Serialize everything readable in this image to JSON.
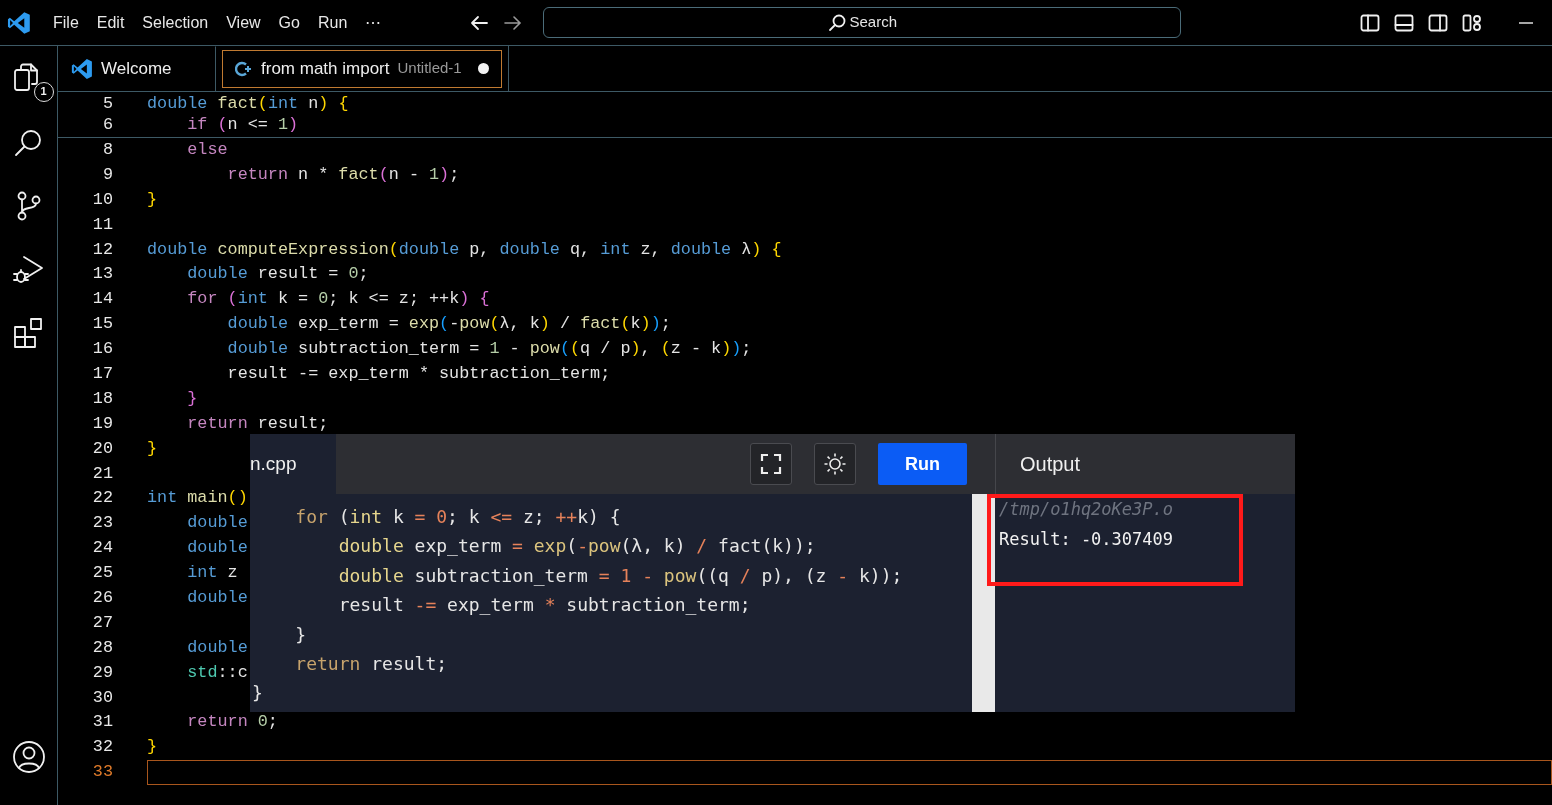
{
  "title_bar": {
    "menu": [
      "File",
      "Edit",
      "Selection",
      "View",
      "Go",
      "Run",
      "⋯"
    ],
    "command_center": "Search"
  },
  "activity_bar": {
    "items": [
      {
        "kind": "explorer",
        "badge": "1"
      },
      {
        "kind": "search"
      },
      {
        "kind": "source_control"
      },
      {
        "kind": "run_debug"
      },
      {
        "kind": "extensions"
      }
    ]
  },
  "tabs": [
    {
      "label": "Welcome",
      "kind": "welcome",
      "selected": false,
      "modified": false
    },
    {
      "label": "from math import",
      "description": "Untitled-1",
      "kind": "cpp",
      "selected": true,
      "modified": true
    }
  ],
  "editor": {
    "sticky_lines": [
      {
        "number": "5",
        "tokens": [
          {
            "text": "double ",
            "kind": "type"
          },
          {
            "text": "fact",
            "kind": "fn"
          },
          {
            "text": "(",
            "kind": "b1"
          },
          {
            "text": "int",
            "kind": "type"
          },
          {
            "text": " n",
            "kind": "plain"
          },
          {
            "text": ") {",
            "kind": "b1"
          }
        ]
      },
      {
        "number": "6",
        "tokens": [
          {
            "text": "    if ",
            "kind": "ctl"
          },
          {
            "text": "(",
            "kind": "b2"
          },
          {
            "text": "n <= ",
            "kind": "plain"
          },
          {
            "text": "1",
            "kind": "num"
          },
          {
            "text": ")",
            "kind": "b2"
          }
        ]
      }
    ],
    "lines": [
      {
        "number": "8",
        "current": false,
        "tokens": [
          {
            "text": "    else",
            "kind": "ctl"
          }
        ]
      },
      {
        "number": "9",
        "current": false,
        "tokens": [
          {
            "text": "        return",
            "kind": "ctl"
          },
          {
            "text": " n * ",
            "kind": "plain"
          },
          {
            "text": "fact",
            "kind": "fn"
          },
          {
            "text": "(",
            "kind": "b2"
          },
          {
            "text": "n - ",
            "kind": "plain"
          },
          {
            "text": "1",
            "kind": "num"
          },
          {
            "text": ")",
            "kind": "b2"
          },
          {
            "text": ";",
            "kind": "plain"
          }
        ]
      },
      {
        "number": "10",
        "current": false,
        "tokens": [
          {
            "text": "}",
            "kind": "b1"
          }
        ]
      },
      {
        "number": "11",
        "current": false
      },
      {
        "number": "12",
        "current": false,
        "tokens": [
          {
            "text": "double ",
            "kind": "type"
          },
          {
            "text": "computeExpression",
            "kind": "fn"
          },
          {
            "text": "(",
            "kind": "b1"
          },
          {
            "text": "double",
            "kind": "type"
          },
          {
            "text": " p, ",
            "kind": "plain"
          },
          {
            "text": "double",
            "kind": "type"
          },
          {
            "text": " q, ",
            "kind": "plain"
          },
          {
            "text": "int",
            "kind": "type"
          },
          {
            "text": " z, ",
            "kind": "plain"
          },
          {
            "text": "double",
            "kind": "type"
          },
          {
            "text": " λ",
            "kind": "plain"
          },
          {
            "text": ") {",
            "kind": "b1"
          }
        ]
      },
      {
        "number": "13",
        "current": false,
        "tokens": [
          {
            "text": "    double",
            "kind": "type"
          },
          {
            "text": " result = ",
            "kind": "plain"
          },
          {
            "text": "0",
            "kind": "num"
          },
          {
            "text": ";",
            "kind": "plain"
          }
        ]
      },
      {
        "number": "14",
        "current": false,
        "tokens": [
          {
            "text": "    for ",
            "kind": "ctl"
          },
          {
            "text": "(",
            "kind": "b2"
          },
          {
            "text": "int",
            "kind": "type"
          },
          {
            "text": " k = ",
            "kind": "plain"
          },
          {
            "text": "0",
            "kind": "num"
          },
          {
            "text": "; k <= z; ++k",
            "kind": "plain"
          },
          {
            "text": ") {",
            "kind": "b2"
          }
        ]
      },
      {
        "number": "15",
        "current": false,
        "tokens": [
          {
            "text": "        double",
            "kind": "type"
          },
          {
            "text": " exp_term = ",
            "kind": "plain"
          },
          {
            "text": "exp",
            "kind": "fn"
          },
          {
            "text": "(",
            "kind": "b3"
          },
          {
            "text": "-",
            "kind": "plain"
          },
          {
            "text": "pow",
            "kind": "fn"
          },
          {
            "text": "(",
            "kind": "b1"
          },
          {
            "text": "λ, k",
            "kind": "plain"
          },
          {
            "text": ")",
            "kind": "b1"
          },
          {
            "text": " / ",
            "kind": "plain"
          },
          {
            "text": "fact",
            "kind": "fn"
          },
          {
            "text": "(",
            "kind": "b1"
          },
          {
            "text": "k",
            "kind": "plain"
          },
          {
            "text": ")",
            "kind": "b1"
          },
          {
            "text": ")",
            "kind": "b3"
          },
          {
            "text": ";",
            "kind": "plain"
          }
        ]
      },
      {
        "number": "16",
        "current": false,
        "tokens": [
          {
            "text": "        double",
            "kind": "type"
          },
          {
            "text": " subtraction_term = ",
            "kind": "plain"
          },
          {
            "text": "1",
            "kind": "num"
          },
          {
            "text": " - ",
            "kind": "plain"
          },
          {
            "text": "pow",
            "kind": "fn"
          },
          {
            "text": "(",
            "kind": "b3"
          },
          {
            "text": "(",
            "kind": "b1"
          },
          {
            "text": "q / p",
            "kind": "plain"
          },
          {
            "text": ")",
            "kind": "b1"
          },
          {
            "text": ", ",
            "kind": "plain"
          },
          {
            "text": "(",
            "kind": "b1"
          },
          {
            "text": "z - k",
            "kind": "plain"
          },
          {
            "text": ")",
            "kind": "b1"
          },
          {
            "text": ")",
            "kind": "b3"
          },
          {
            "text": ";",
            "kind": "plain"
          }
        ]
      },
      {
        "number": "17",
        "current": false,
        "tokens": [
          {
            "text": "        result -= exp_term * subtraction_term;",
            "kind": "plain"
          }
        ]
      },
      {
        "number": "18",
        "current": false,
        "tokens": [
          {
            "text": "    }",
            "kind": "b2"
          }
        ]
      },
      {
        "number": "19",
        "current": false,
        "tokens": [
          {
            "text": "    return",
            "kind": "ctl"
          },
          {
            "text": " result;",
            "kind": "plain"
          }
        ]
      },
      {
        "number": "20",
        "current": false,
        "tokens": [
          {
            "text": "}",
            "kind": "b1"
          }
        ]
      },
      {
        "number": "21",
        "current": false
      },
      {
        "number": "22",
        "current": false,
        "tokens": [
          {
            "text": "int ",
            "kind": "type"
          },
          {
            "text": "main",
            "kind": "fn"
          },
          {
            "text": "()",
            "kind": "b1"
          }
        ]
      },
      {
        "number": "23",
        "current": false,
        "tokens": [
          {
            "text": "    double",
            "kind": "type"
          }
        ]
      },
      {
        "number": "24",
        "current": false,
        "tokens": [
          {
            "text": "    double",
            "kind": "type"
          }
        ]
      },
      {
        "number": "25",
        "current": false,
        "tokens": [
          {
            "text": "    int",
            "kind": "type"
          },
          {
            "text": " z",
            "kind": "plain"
          }
        ]
      },
      {
        "number": "26",
        "current": false,
        "tokens": [
          {
            "text": "    double",
            "kind": "type"
          }
        ]
      },
      {
        "number": "27",
        "current": false
      },
      {
        "number": "28",
        "current": false,
        "tokens": [
          {
            "text": "    double",
            "kind": "type"
          }
        ]
      },
      {
        "number": "29",
        "current": false,
        "tokens": [
          {
            "text": "    std",
            "kind": "ns"
          },
          {
            "text": "::c",
            "kind": "plain"
          }
        ]
      },
      {
        "number": "30",
        "current": false
      },
      {
        "number": "31",
        "current": false,
        "tokens": [
          {
            "text": "    return ",
            "kind": "ctl"
          },
          {
            "text": "0",
            "kind": "num"
          },
          {
            "text": ";",
            "kind": "plain"
          }
        ]
      },
      {
        "number": "32",
        "current": false,
        "tokens": [
          {
            "text": "}",
            "kind": "b1"
          }
        ]
      },
      {
        "number": "33",
        "current": true
      }
    ]
  },
  "compiler_panel": {
    "file_tab": "n.cpp",
    "run_label": "Run",
    "output_title": "Output",
    "highlight_output": true,
    "code_lines": [
      {
        "tokens": [
          {
            "text": "    for",
            "kind": "keyword"
          },
          {
            "text": " (",
            "kind": "plain"
          },
          {
            "text": "int",
            "kind": "type"
          },
          {
            "text": " k ",
            "kind": "plain"
          },
          {
            "text": "= ",
            "kind": "operator"
          },
          {
            "text": "0",
            "kind": "number"
          },
          {
            "text": "; k ",
            "kind": "plain"
          },
          {
            "text": "<=",
            "kind": "operator"
          },
          {
            "text": " z; ",
            "kind": "plain"
          },
          {
            "text": "++",
            "kind": "operator"
          },
          {
            "text": "k) {",
            "kind": "plain"
          }
        ]
      },
      {
        "tokens": [
          {
            "text": "        double",
            "kind": "type"
          },
          {
            "text": " exp_term ",
            "kind": "plain"
          },
          {
            "text": "= ",
            "kind": "operator"
          },
          {
            "text": "exp",
            "kind": "function"
          },
          {
            "text": "(",
            "kind": "plain"
          },
          {
            "text": "-",
            "kind": "operator"
          },
          {
            "text": "pow",
            "kind": "function"
          },
          {
            "text": "(λ, k) ",
            "kind": "plain"
          },
          {
            "text": "/",
            "kind": "operator"
          },
          {
            "text": " fact(k));",
            "kind": "plain"
          }
        ]
      },
      {
        "tokens": [
          {
            "text": "        double",
            "kind": "type"
          },
          {
            "text": " subtraction_term ",
            "kind": "plain"
          },
          {
            "text": "= ",
            "kind": "operator"
          },
          {
            "text": "1 ",
            "kind": "number"
          },
          {
            "text": "- ",
            "kind": "operator"
          },
          {
            "text": "pow",
            "kind": "function"
          },
          {
            "text": "((q ",
            "kind": "plain"
          },
          {
            "text": "/",
            "kind": "operator"
          },
          {
            "text": " p), (z ",
            "kind": "plain"
          },
          {
            "text": "-",
            "kind": "operator"
          },
          {
            "text": " k));",
            "kind": "plain"
          }
        ]
      },
      {
        "tokens": [
          {
            "text": "        result ",
            "kind": "plain"
          },
          {
            "text": "-=",
            "kind": "operator"
          },
          {
            "text": " exp_term ",
            "kind": "plain"
          },
          {
            "text": "*",
            "kind": "operator"
          },
          {
            "text": " subtraction_term;",
            "kind": "plain"
          }
        ]
      },
      {
        "tokens": [
          {
            "text": "    }",
            "kind": "plain"
          }
        ]
      },
      {
        "tokens": [
          {
            "text": "    return",
            "kind": "keyword"
          },
          {
            "text": " result;",
            "kind": "plain"
          }
        ]
      },
      {
        "tokens": [
          {
            "text": "}",
            "kind": "plain"
          }
        ]
      }
    ],
    "output_lines": [
      {
        "text": "/tmp/o1hq2oKe3P.o",
        "kind": "path"
      },
      {
        "text": "Result: -0.307409",
        "kind": "result"
      }
    ]
  }
}
